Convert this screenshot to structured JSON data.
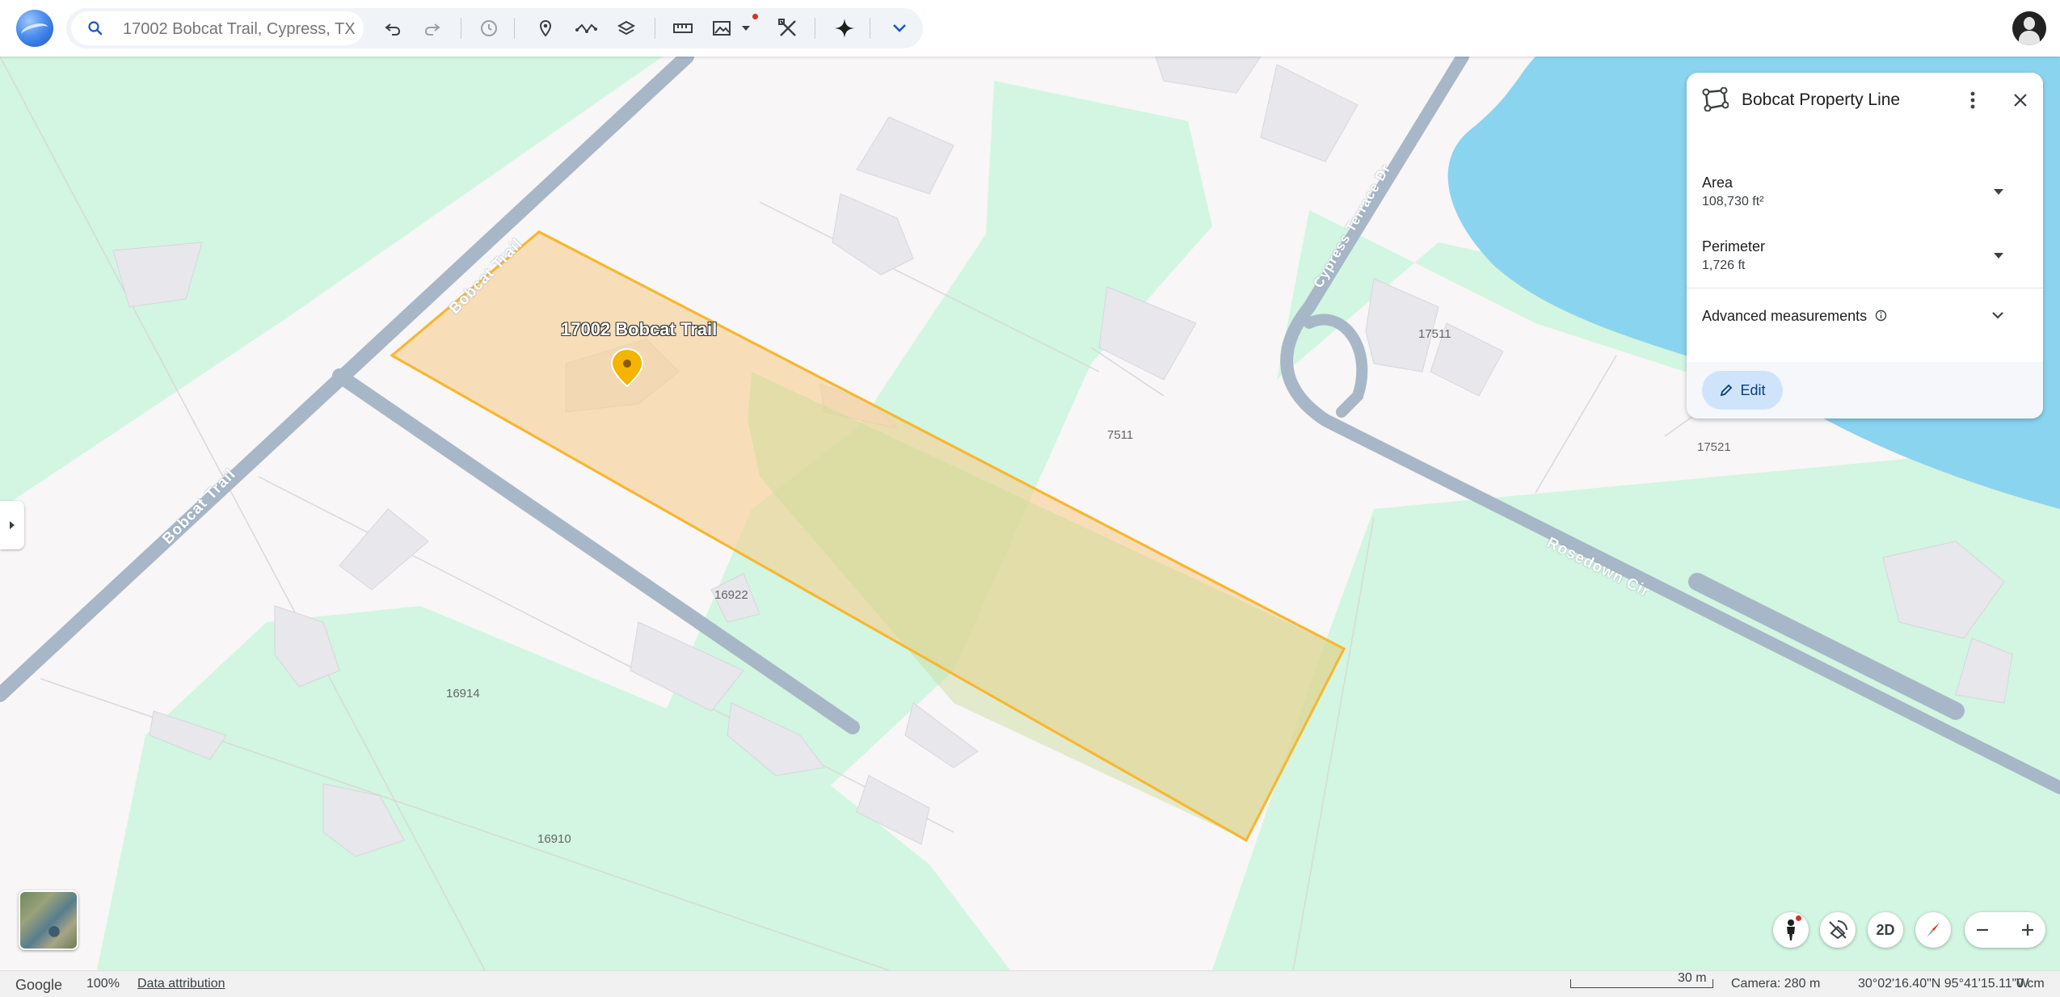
{
  "search": {
    "placeholder": "17002 Bobcat Trail, Cypress, TX"
  },
  "toolbar": {
    "icons": [
      "search-icon",
      "undo-icon",
      "redo-icon",
      "history-icon",
      "pin-icon",
      "path-icon",
      "layers-icon",
      "ruler-icon",
      "image-icon",
      "tools-icon",
      "sparkle-icon",
      "chevron-down-icon"
    ]
  },
  "map": {
    "place_name": "17002 Bobcat Trail",
    "roads": [
      "Bobcat Trail",
      "Bobcat Trail",
      "Cypress Terrace Dr",
      "Rosedown Cir"
    ],
    "lot_numbers": [
      "7511",
      "17511",
      "17521",
      "16922",
      "16914",
      "16910"
    ],
    "polygon_color": "#f7b731",
    "polygon_fill": "#f9cf8f",
    "water_color": "#8ad4f0",
    "grass_color": "#d2f6e1"
  },
  "panel": {
    "title": "Bobcat Property Line",
    "area_label": "Area",
    "area_value": "108,730 ft²",
    "perimeter_label": "Perimeter",
    "perimeter_value": "1,726 ft",
    "advanced_label": "Advanced measurements",
    "edit_label": "Edit"
  },
  "controls": {
    "view_mode": "2D"
  },
  "status": {
    "brand": "Google",
    "zoom": "100%",
    "attribution": "Data attribution",
    "scale": "30 m",
    "camera": "Camera: 280 m",
    "coords": "30°02'16.40\"N 95°41'15.11\"W",
    "elevation": "0 cm"
  }
}
